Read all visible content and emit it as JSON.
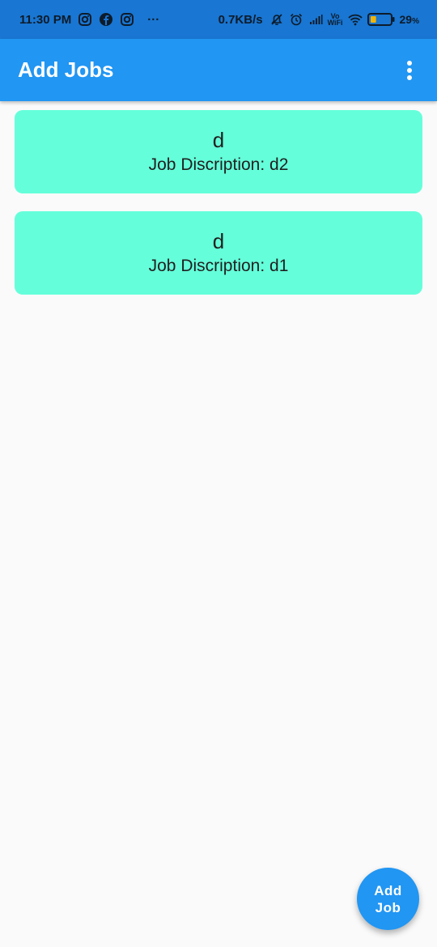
{
  "status_bar": {
    "time": "11:30 PM",
    "overflow_dots": "···",
    "network_speed": "0.7KB/s",
    "vowifi_top": "Vo",
    "vowifi_bottom": "WiFi",
    "battery_percent": "29",
    "battery_unit": "%",
    "battery_level": 0.29
  },
  "app_bar": {
    "title": "Add Jobs"
  },
  "jobs": [
    {
      "title": "d",
      "description": "Job Discription: d2"
    },
    {
      "title": "d",
      "description": "Job Discription: d1"
    }
  ],
  "fab": {
    "label": "Add Job"
  },
  "colors": {
    "status_bar_bg": "#1976d2",
    "app_bar_bg": "#2196f3",
    "card_bg": "#64ffda",
    "page_bg": "#fafafa"
  }
}
